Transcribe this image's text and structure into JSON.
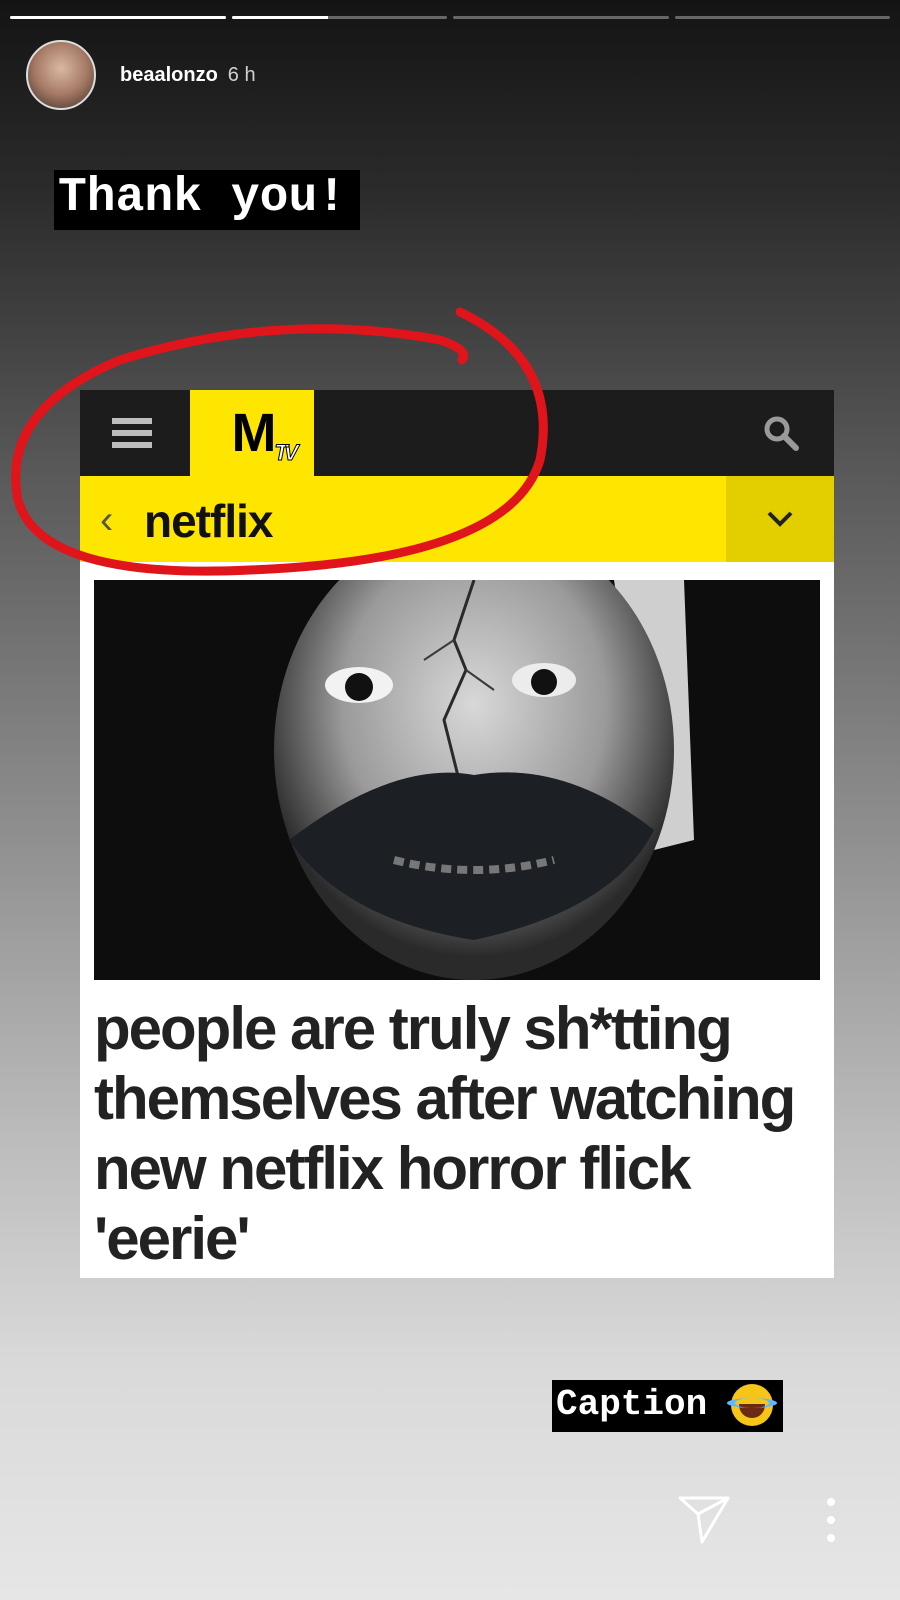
{
  "story": {
    "progress": [
      1.0,
      0.45,
      0.0,
      0.0
    ],
    "username": "beaalonzo",
    "time": "6 h"
  },
  "stickers": {
    "top_text": "Thank you!",
    "bottom_text": "Caption",
    "bottom_emoji": "face-with-tears-of-joy-icon"
  },
  "mtv": {
    "brand_color": "#ffe600",
    "logo": "MTV",
    "section": "netflix",
    "headline": "people are truly sh*tting themselves after watching new netflix horror flick 'eerie'",
    "icons": [
      "menu-icon",
      "search-icon",
      "chevron-left-icon",
      "chevron-down-icon"
    ]
  },
  "annotation": {
    "color": "#e0141b"
  },
  "footer": {
    "icons": [
      "send-icon",
      "more-icon"
    ]
  }
}
